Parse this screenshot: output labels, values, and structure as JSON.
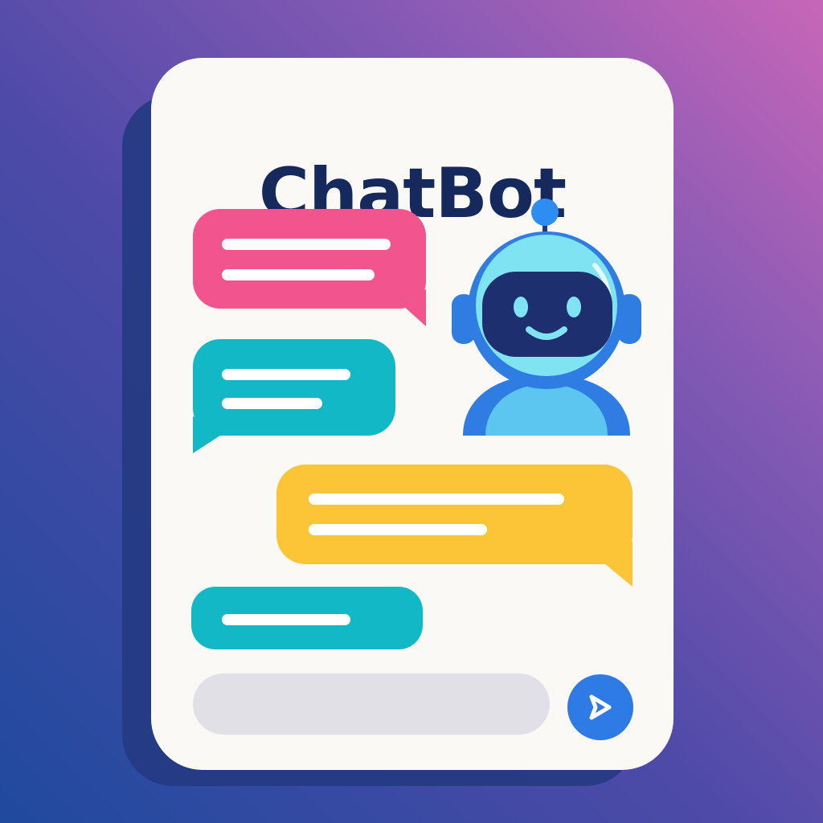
{
  "app": {
    "title": "ChatBot"
  },
  "composer": {
    "value": "",
    "placeholder": ""
  },
  "icons": {
    "robot": "robot-avatar-icon",
    "send": "send-arrow-icon"
  },
  "colors": {
    "bubble_pink": "#f2548e",
    "bubble_teal": "#12b8c6",
    "bubble_yellow": "#fcc437",
    "title": "#16295c",
    "send_button": "#2e7be6",
    "robot_head": "#7fe3f2",
    "robot_visor": "#1d2f6e"
  }
}
